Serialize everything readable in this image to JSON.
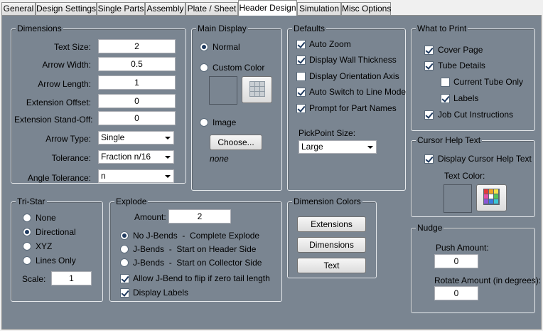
{
  "tabs": [
    {
      "label": "General"
    },
    {
      "label": "Design Settings"
    },
    {
      "label": "Single Parts"
    },
    {
      "label": "Assembly"
    },
    {
      "label": "Plate / Sheet"
    },
    {
      "label": "Header Design"
    },
    {
      "label": "Simulation"
    },
    {
      "label": "Misc Options"
    }
  ],
  "active_tab": "Header Design",
  "dimensions": {
    "title": "Dimensions",
    "text_size_label": "Text Size:",
    "text_size": "2",
    "arrow_width_label": "Arrow Width:",
    "arrow_width": "0.5",
    "arrow_length_label": "Arrow Length:",
    "arrow_length": "1",
    "extension_offset_label": "Extension Offset:",
    "extension_offset": "0",
    "extension_standoff_label": "Extension Stand-Off:",
    "extension_standoff": "0",
    "arrow_type_label": "Arrow Type:",
    "arrow_type": "Single",
    "tolerance_label": "Tolerance:",
    "tolerance": "Fraction n/16",
    "angle_tolerance_label": "Angle Tolerance:",
    "angle_tolerance": "n"
  },
  "main_display": {
    "title": "Main Display",
    "normal_label": "Normal",
    "custom_color_label": "Custom Color",
    "image_label": "Image",
    "choose_label": "Choose...",
    "image_value": "none",
    "selected": "Normal"
  },
  "defaults": {
    "title": "Defaults",
    "items": [
      {
        "label": "Auto Zoom",
        "checked": true
      },
      {
        "label": "Display Wall Thickness",
        "checked": true
      },
      {
        "label": "Display Orientation Axis",
        "checked": false
      },
      {
        "label": "Auto Switch to Line Mode",
        "checked": true
      },
      {
        "label": "Prompt for Part Names",
        "checked": true
      }
    ],
    "pickpoint_label": "PickPoint Size:",
    "pickpoint_value": "Large"
  },
  "what_to_print": {
    "title": "What to Print",
    "items": [
      {
        "label": "Cover Page",
        "checked": true
      },
      {
        "label": "Tube Details",
        "checked": true
      },
      {
        "label": "Current Tube Only",
        "checked": false
      },
      {
        "label": "Labels",
        "checked": true
      },
      {
        "label": "Job Cut Instructions",
        "checked": true
      }
    ]
  },
  "cursor_help": {
    "title": "Cursor Help Text",
    "display_label": "Display Cursor Help Text",
    "display_checked": true,
    "text_color_label": "Text Color:"
  },
  "tri_star": {
    "title": "Tri-Star",
    "options": [
      "None",
      "Directional",
      "XYZ",
      "Lines Only"
    ],
    "selected": "Directional",
    "scale_label": "Scale:",
    "scale": "1"
  },
  "explode": {
    "title": "Explode",
    "amount_label": "Amount:",
    "amount": "2",
    "options": [
      "No J-Bends  -  Complete Explode",
      "J-Bends  -  Start on Header Side",
      "J-Bends  -  Start on Collector Side"
    ],
    "selected": "No J-Bends  -  Complete Explode",
    "allow_jbend_label": "Allow J-Bend to flip if zero tail length",
    "allow_jbend_checked": true,
    "display_labels_label": "Display Labels",
    "display_labels_checked": true
  },
  "dimension_colors": {
    "title": "Dimension Colors",
    "extensions_label": "Extensions",
    "dimensions_label": "Dimensions",
    "text_label": "Text"
  },
  "nudge": {
    "title": "Nudge",
    "push_label": "Push Amount:",
    "push": "0",
    "rotate_label": "Rotate Amount (in degrees):",
    "rotate": "0"
  },
  "colors": {
    "panel_bg": "#7a8591",
    "group_border": "#e6e9ec",
    "swatch": "#7a8591"
  }
}
